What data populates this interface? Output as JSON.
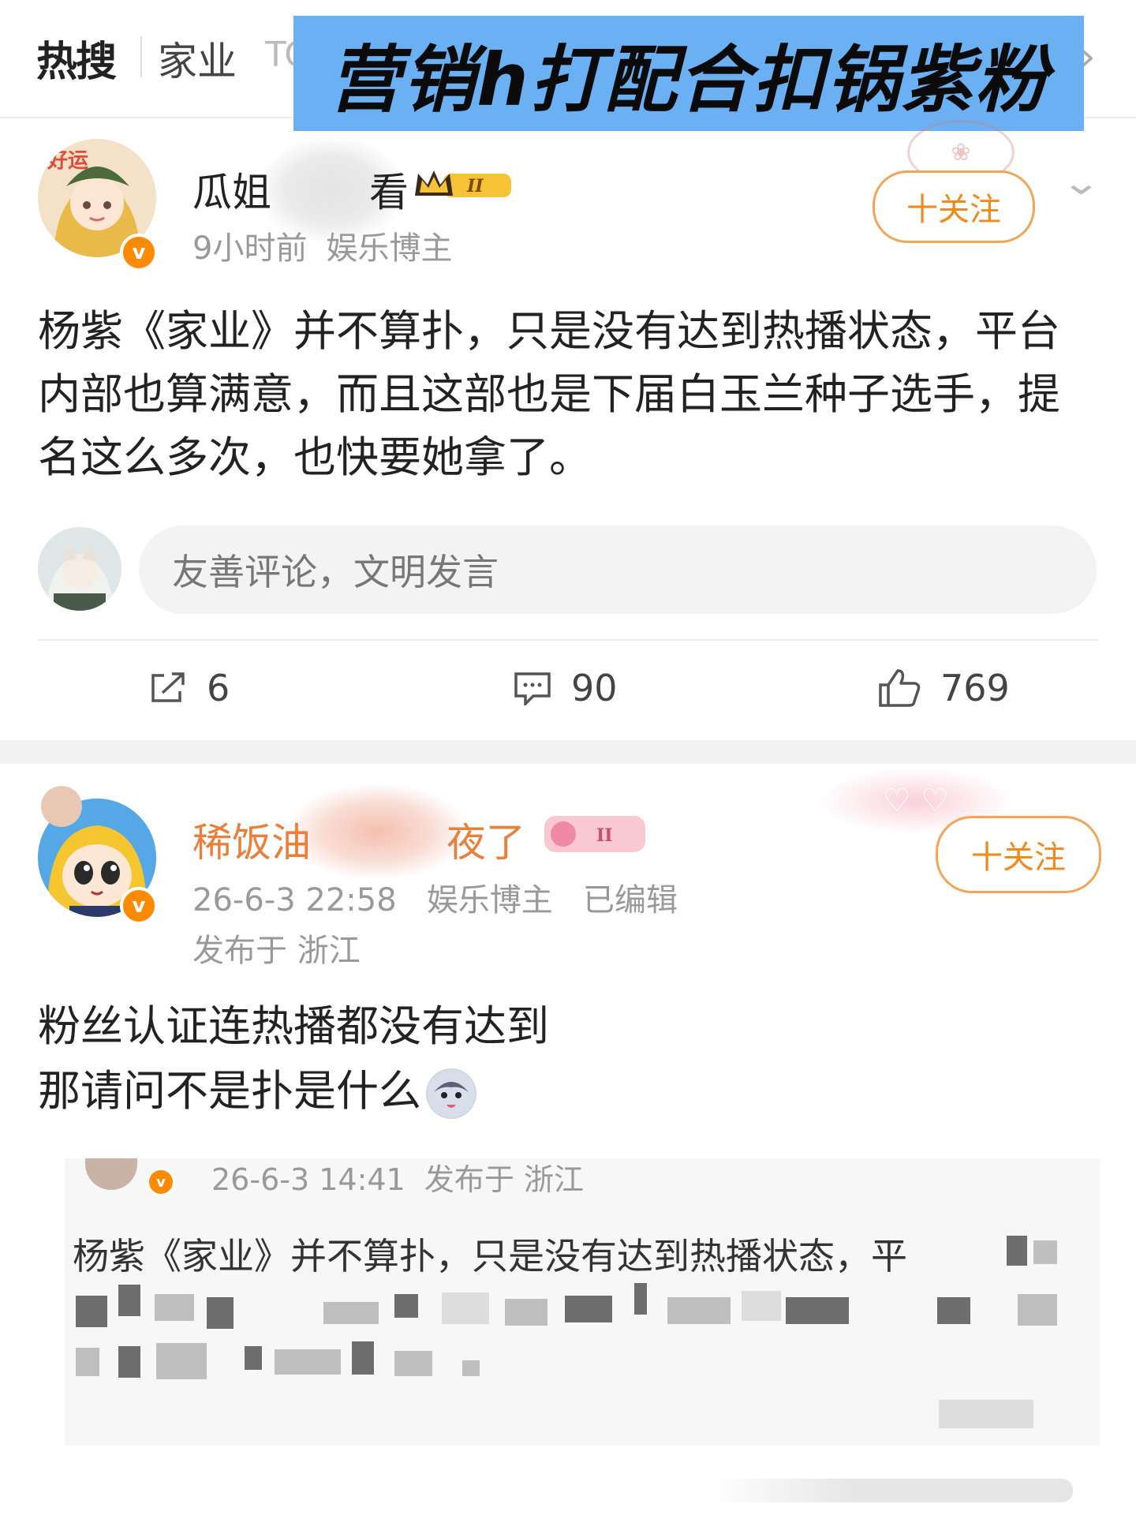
{
  "topbar": {
    "logo": "热搜",
    "tab": "家业",
    "tab_next": "TC"
  },
  "banner": {
    "text": "营销h打配合扣锅紫粉",
    "color": "#6ab0f3"
  },
  "post1": {
    "name_visible_start": "瓜姐",
    "name_visible_end": "看",
    "time": "9小时前",
    "role": "娱乐博主",
    "follow_label": "十关注",
    "body": "杨紫《家业》并不算扑，只是没有达到热播状态，平台内部也算满意，而且这部也是下届白玉兰种子选手，提名这么多次，也快要她拿了。",
    "comment_placeholder": "友善评论，文明发言",
    "actions": {
      "share_count": "6",
      "comment_count": "90",
      "like_count": "769"
    }
  },
  "post2": {
    "name_visible_start": "稀饭油",
    "name_visible_end": "夜了",
    "time": "26-6-3 22:58",
    "role": "娱乐博主",
    "edited": "已编辑",
    "location": "发布于 浙江",
    "follow_label": "十关注",
    "body_line1": "粉丝认证连热播都没有达到",
    "body_line2": "那请问不是扑是什么",
    "quote": {
      "time": "26-6-3 14:41",
      "location": "发布于 浙江",
      "text": "杨紫《家业》并不算扑，只是没有达到热播状态，平"
    }
  },
  "colors": {
    "accent_orange": "#f08a1c",
    "name_orange": "#e8803c",
    "verified_badge": "#ff8a00"
  },
  "icons": [
    "share-icon",
    "comment-icon",
    "like-icon",
    "chevron-down-icon",
    "chevron-right-icon",
    "verified-icon",
    "crown-icon"
  ]
}
